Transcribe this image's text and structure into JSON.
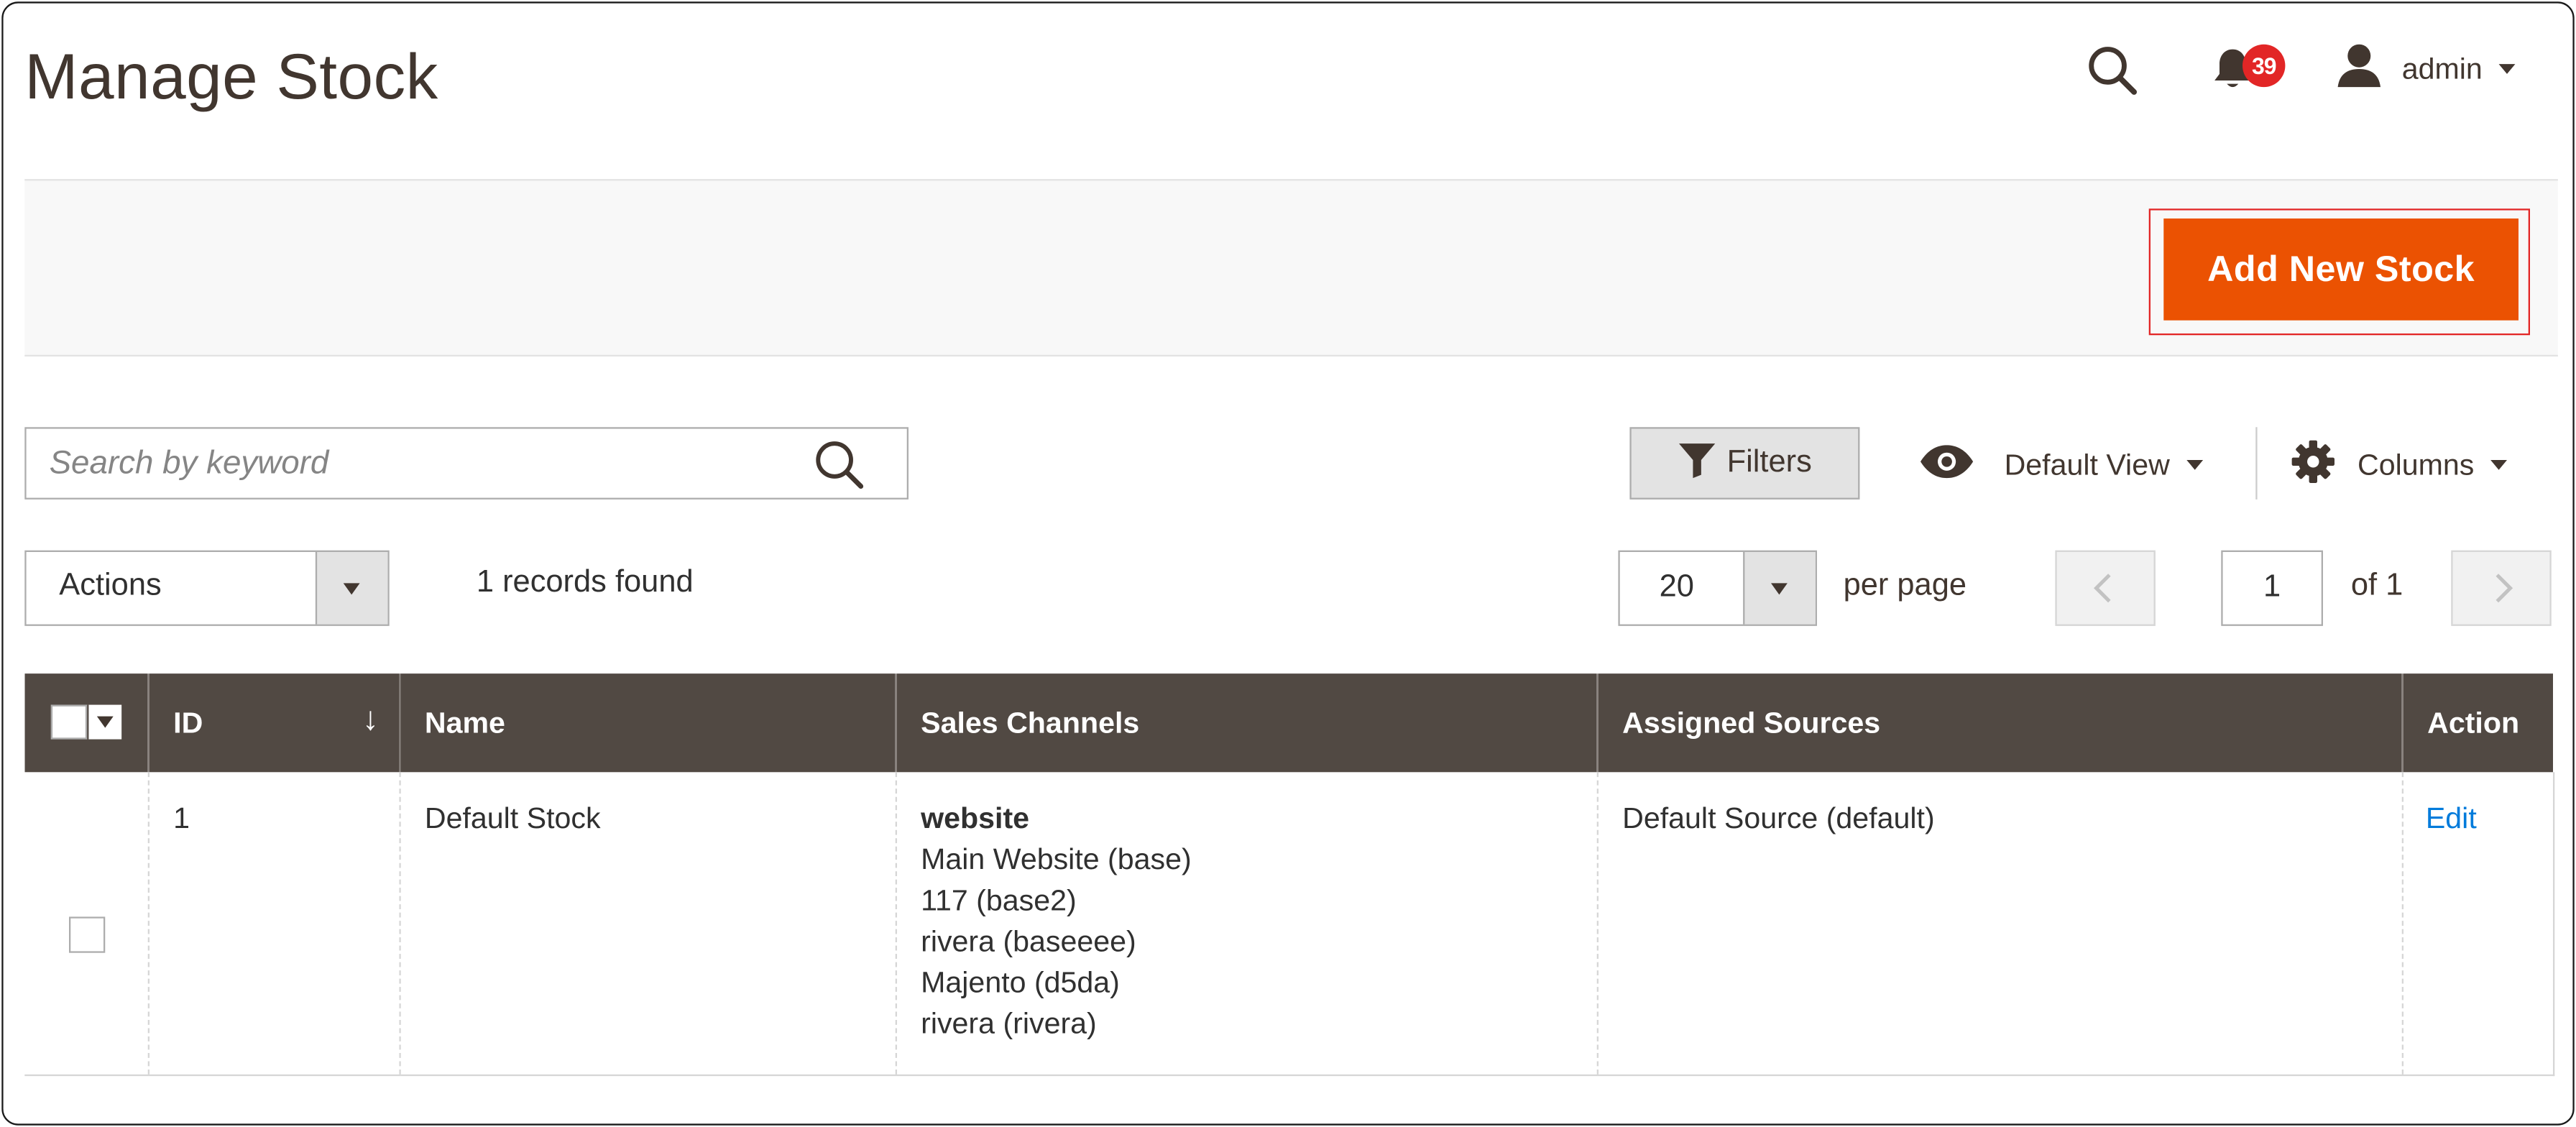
{
  "header": {
    "title": "Manage Stock",
    "notifications_count": "39",
    "user_name": "admin"
  },
  "actionbar": {
    "add_button_label": "Add New Stock"
  },
  "toolbar": {
    "search_placeholder": "Search by keyword",
    "filters_label": "Filters",
    "view_label": "Default View",
    "columns_label": "Columns",
    "actions_label": "Actions",
    "records_found": "1 records found",
    "per_page_value": "20",
    "per_page_label": "per page",
    "page_value": "1",
    "page_of": "of 1"
  },
  "grid": {
    "columns": [
      "ID",
      "Name",
      "Sales Channels",
      "Assigned Sources",
      "Action"
    ],
    "rows": [
      {
        "id": "1",
        "name": "Default Stock",
        "sales_channels_title": "website",
        "sales_channels": [
          "Main Website (base)",
          "117 (base2)",
          "rivera (baseeee)",
          "Majento (d5da)",
          "rivera (rivera)"
        ],
        "assigned_sources": "Default Source (default)",
        "action": "Edit"
      }
    ]
  },
  "colors": {
    "accent": "#eb5202",
    "table_header": "#514943",
    "badge": "#e22626",
    "link": "#007bdb"
  }
}
